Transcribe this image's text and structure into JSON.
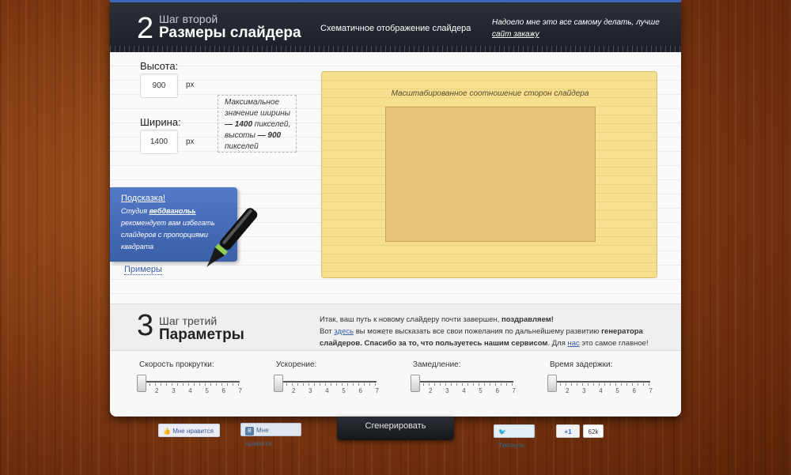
{
  "header": {
    "step_number": "2",
    "step_sub": "Шаг второй",
    "step_title": "Размеры слайдера",
    "schematic_label": "Схематичное отображение слайдера",
    "tired_text": "Надоело мне это все самому делать, лучше ",
    "tired_link": "сайт закажу"
  },
  "dimensions": {
    "height_label": "Высота:",
    "height_value": "900",
    "width_label": "Ширина:",
    "width_value": "1400",
    "unit": "px",
    "note_pre": "Максимальное значение ширины ",
    "note_w": "— 1400",
    "note_mid": " пикселей, высоты ",
    "note_h": "— 900",
    "note_post": " пикселей"
  },
  "tip": {
    "title": "Подсказка!",
    "text_pre": "Студия ",
    "brand": "вебдванольь",
    "text_post": " рекомендует вам избегать слайдеров с пропорциями квадрата",
    "examples": "Примеры"
  },
  "preview": {
    "caption": "Масштабированное соотношение сторон слайдера"
  },
  "step3": {
    "number": "3",
    "sub": "Шаг третий",
    "title": "Параметры",
    "line1_pre": "Итак, ваш путь к новому слайдеру почти завершен, ",
    "line1_bold": "поздравляем!",
    "line2_pre": "Вот ",
    "line2_link": "здесь",
    "line2_mid": " вы можете высказать все свои пожелания по дальнейшему развитию ",
    "line2_bold": "генератора слайдеров",
    "line2_post": ". Спасибо за то, что пользуетесь нашим сервисом",
    "line2_post2": ". Для ",
    "line2_link2": "нас",
    "line2_end": " это самое главное!"
  },
  "sliders": [
    {
      "label": "Скорость прокрутки:",
      "value": 1,
      "ticks": [
        "2",
        "3",
        "4",
        "5",
        "6",
        "7"
      ]
    },
    {
      "label": "Ускорение:",
      "value": 1,
      "ticks": [
        "2",
        "3",
        "4",
        "5",
        "6",
        "7"
      ]
    },
    {
      "label": "Замедление:",
      "value": 1,
      "ticks": [
        "2",
        "3",
        "4",
        "5",
        "6",
        "7"
      ]
    },
    {
      "label": "Время задержки:",
      "value": 1,
      "ticks": [
        "2",
        "3",
        "4",
        "5",
        "6",
        "7"
      ]
    }
  ],
  "footer": {
    "generate": "Сгенерировать",
    "fb_like": "Мне нравится",
    "vk_like": "Мне нравится",
    "vk_badge": "В",
    "tweet": "Твитнуть",
    "gplus": "+1",
    "gplus_count": "62k"
  }
}
